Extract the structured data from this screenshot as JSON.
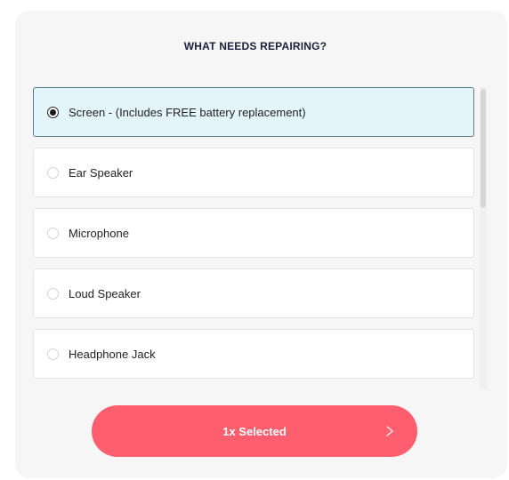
{
  "title": "WHAT NEEDS REPAIRING?",
  "options": [
    {
      "label": "Screen - (Includes FREE battery replacement)",
      "selected": true
    },
    {
      "label": "Ear Speaker",
      "selected": false
    },
    {
      "label": "Microphone",
      "selected": false
    },
    {
      "label": "Loud Speaker",
      "selected": false
    },
    {
      "label": "Headphone Jack",
      "selected": false
    }
  ],
  "cta": {
    "label": "1x Selected",
    "icon": "chevron-right-icon"
  },
  "colors": {
    "accent": "#ff5e6e",
    "selected_bg": "#e3f5fb",
    "selected_border": "#5d7b86",
    "title": "#1c1f3a"
  }
}
